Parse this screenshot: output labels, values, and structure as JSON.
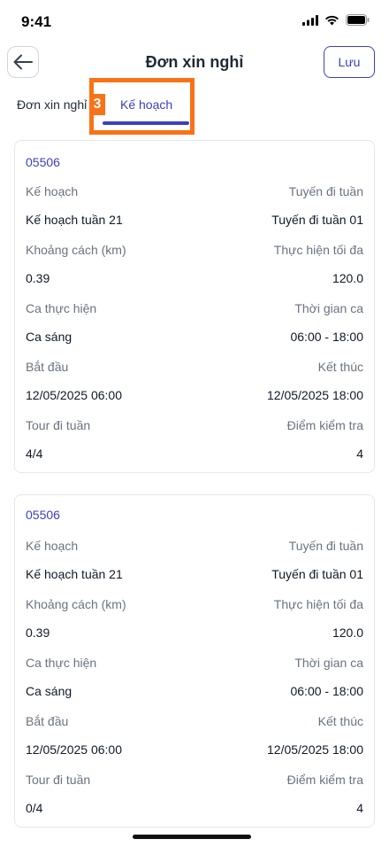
{
  "status_bar": {
    "time": "9:41"
  },
  "header": {
    "title": "Đơn xin nghỉ",
    "save_label": "Lưu"
  },
  "tabs": {
    "leave_label": "Đơn xin nghỉ",
    "plan_label": "Kế hoạch",
    "badge": "3"
  },
  "cards": [
    {
      "id": "05506",
      "plan_label": "Kế hoạch",
      "plan_value": "Kế hoạch tuần 21",
      "route_label": "Tuyến đi tuần",
      "route_value": "Tuyến đi tuần 01",
      "distance_label": "Khoảng cách (km)",
      "distance_value": "0.39",
      "max_label": "Thực hiện tối đa",
      "max_value": "120.0",
      "shift_label": "Ca thực hiện",
      "shift_value": "Ca sáng",
      "shift_time_label": "Thời gian ca",
      "shift_time_value": "06:00 - 18:00",
      "start_label": "Bắt đầu",
      "start_value": "12/05/2025 06:00",
      "end_label": "Kết thúc",
      "end_value": "12/05/2025 18:00",
      "tour_label": "Tour đi tuần",
      "tour_value": "4/4",
      "checkpoint_label": "Điểm kiểm tra",
      "checkpoint_value": "4"
    },
    {
      "id": "05506",
      "plan_label": "Kế hoạch",
      "plan_value": "Kế hoạch tuần 21",
      "route_label": "Tuyến đi tuần",
      "route_value": "Tuyến đi tuần 01",
      "distance_label": "Khoảng cách (km)",
      "distance_value": "0.39",
      "max_label": "Thực hiện tối đa",
      "max_value": "120.0",
      "shift_label": "Ca thực hiện",
      "shift_value": "Ca sáng",
      "shift_time_label": "Thời gian ca",
      "shift_time_value": "06:00 - 18:00",
      "start_label": "Bắt đầu",
      "start_value": "12/05/2025 06:00",
      "end_label": "Kết thúc",
      "end_value": "12/05/2025 18:00",
      "tour_label": "Tour đi tuần",
      "tour_value": "0/4",
      "checkpoint_label": "Điểm kiểm tra",
      "checkpoint_value": "4"
    }
  ]
}
